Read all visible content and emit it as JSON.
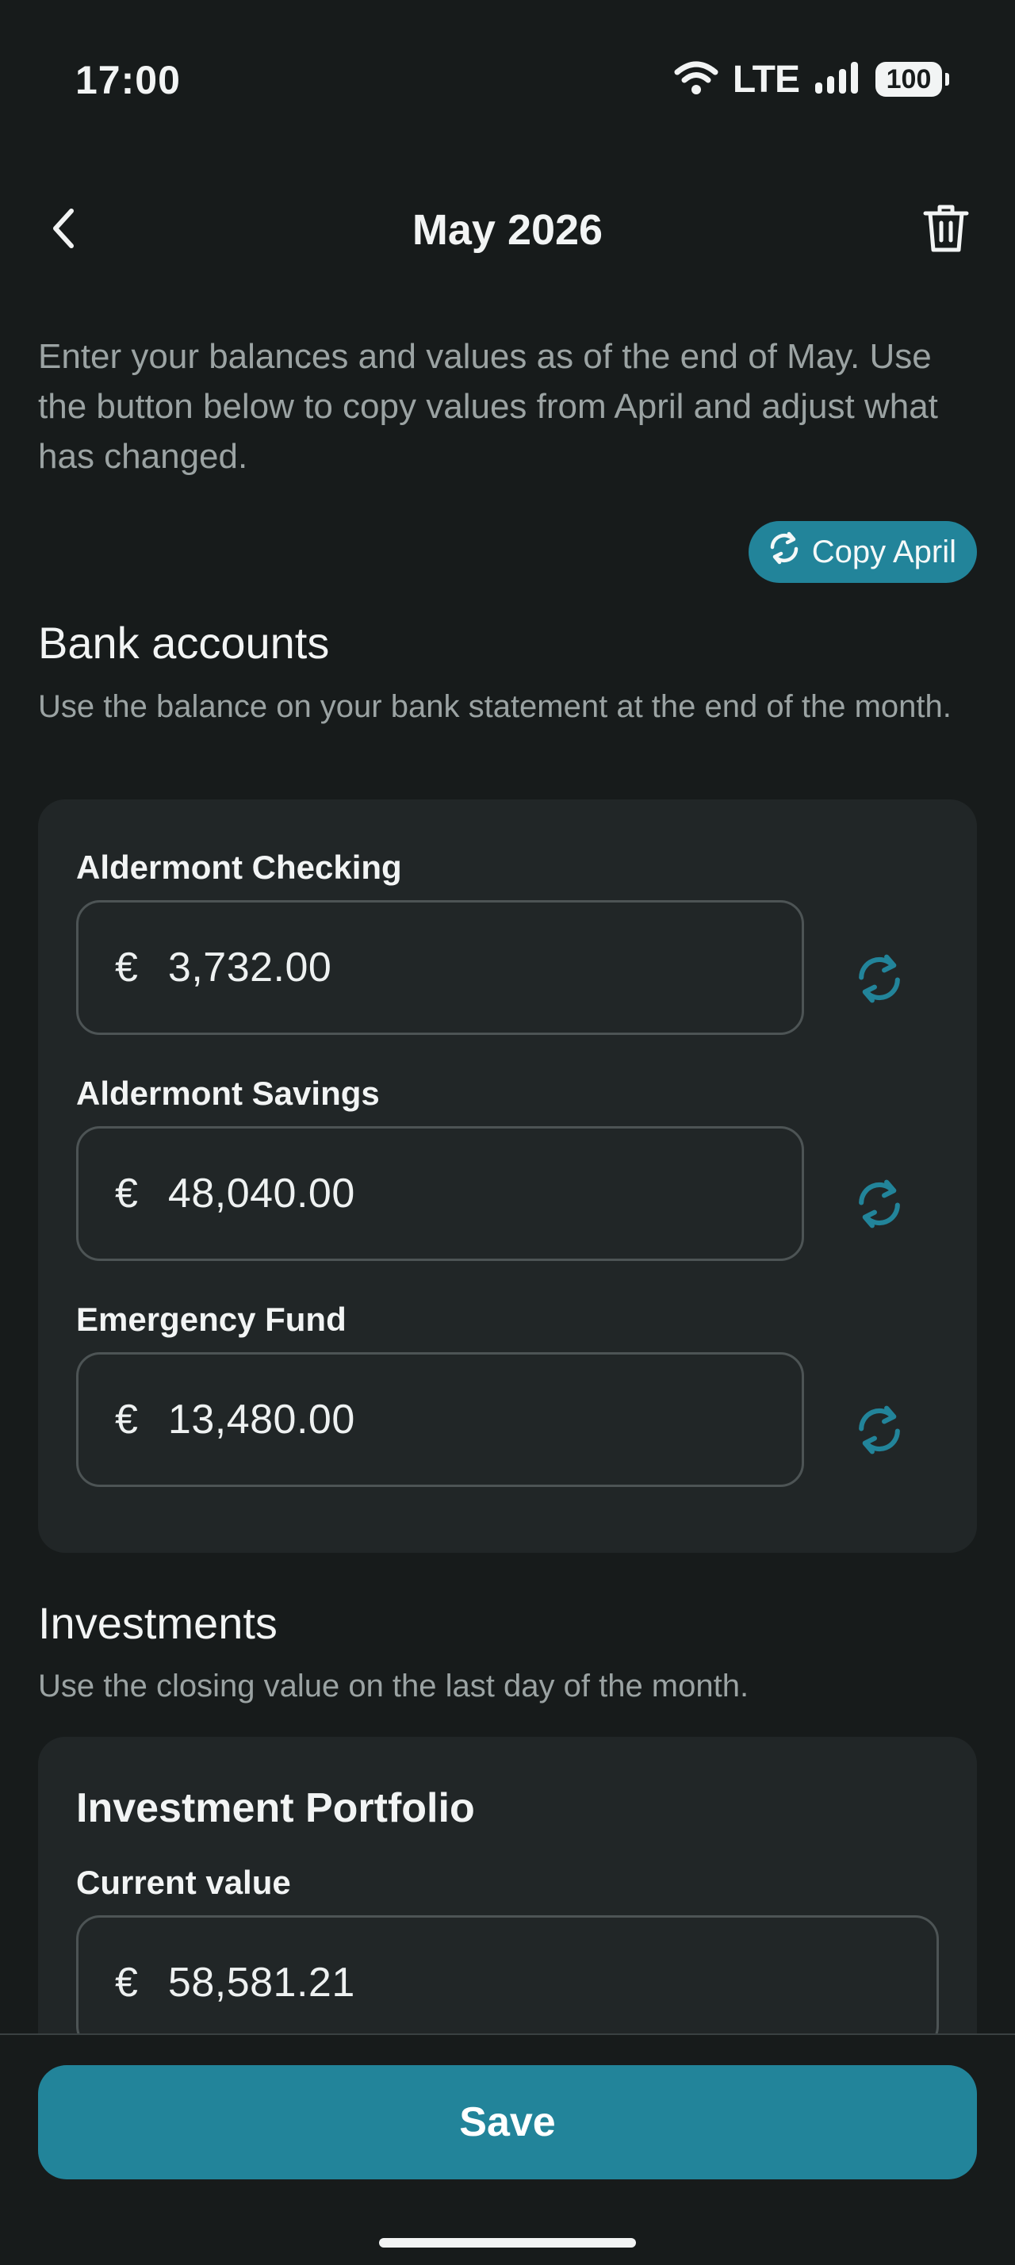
{
  "status_bar": {
    "time": "17:00",
    "network": "LTE",
    "battery": "100",
    "icons": [
      "wifi-icon",
      "signal-icon",
      "battery-icon"
    ]
  },
  "header": {
    "title": "May 2026",
    "icons": [
      "chevron-left-icon",
      "trash-icon"
    ]
  },
  "intro_text": "Enter your balances and values as of the end of May. Use the button below to copy values from April and adjust what has changed.",
  "copy_button": {
    "label": "Copy April",
    "icon": "refresh-icon"
  },
  "bank_accounts": {
    "title": "Bank accounts",
    "description": "Use the balance on your bank statement at the end of the month.",
    "accounts": [
      {
        "label": "Aldermont Checking",
        "currency": "€",
        "value": "3,732.00"
      },
      {
        "label": "Aldermont Savings",
        "currency": "€",
        "value": "48,040.00"
      },
      {
        "label": "Emergency Fund",
        "currency": "€",
        "value": "13,480.00"
      }
    ]
  },
  "investments": {
    "title": "Investments",
    "description": "Use the closing value on the last day of the month.",
    "portfolio": {
      "title": "Investment Portfolio",
      "field_label": "Current value",
      "currency": "€",
      "value": "58,581.21"
    }
  },
  "footer": {
    "save_label": "Save"
  },
  "colors": {
    "background": "#171b1b",
    "card": "#212627",
    "accent": "#22849a",
    "muted_text": "#9ba3a3"
  }
}
